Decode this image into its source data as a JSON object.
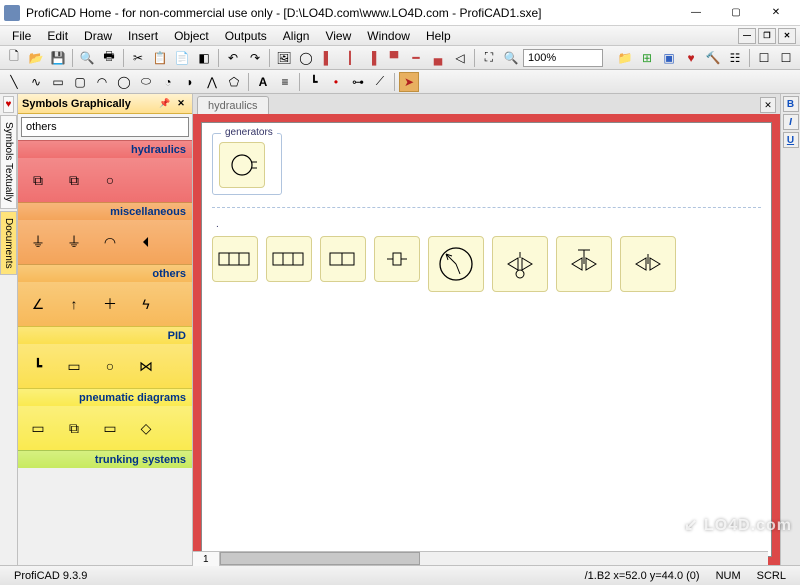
{
  "window": {
    "title": "ProfiCAD Home - for non-commercial use only - [D:\\LO4D.com\\www.LO4D.com - ProfiCAD1.sxe]"
  },
  "menubar": {
    "items": [
      "File",
      "Edit",
      "Draw",
      "Insert",
      "Object",
      "Outputs",
      "Align",
      "View",
      "Window",
      "Help"
    ]
  },
  "toolbar1": {
    "zoom": "100%"
  },
  "left_tabs": {
    "favorites": "♥",
    "textual": "Symbols Textually",
    "documents": "Documents"
  },
  "symbols_panel": {
    "title": "Symbols Graphically",
    "combo_value": "others",
    "categories": [
      {
        "name": "hydraulics",
        "bg": "bg-red"
      },
      {
        "name": "miscellaneous",
        "bg": "bg-orange"
      },
      {
        "name": "others",
        "bg": "bg-oranger"
      },
      {
        "name": "PID",
        "bg": "bg-yellow"
      },
      {
        "name": "pneumatic diagrams",
        "bg": "bg-yellow2"
      },
      {
        "name": "trunking systems",
        "bg": "bg-green"
      }
    ]
  },
  "document": {
    "tab": "hydraulics",
    "group1_label": "generators",
    "group2_label": "."
  },
  "sheet": {
    "tab": "1"
  },
  "statusbar": {
    "version": "ProfiCAD 9.3.9",
    "coords": "/1.B2  x=52.0  y=44.0 (0)",
    "num": "NUM",
    "scrl": "SCRL"
  },
  "format_btns": {
    "b": "B",
    "i": "I",
    "u": "U"
  },
  "watermark": "↙ LO4D.com"
}
